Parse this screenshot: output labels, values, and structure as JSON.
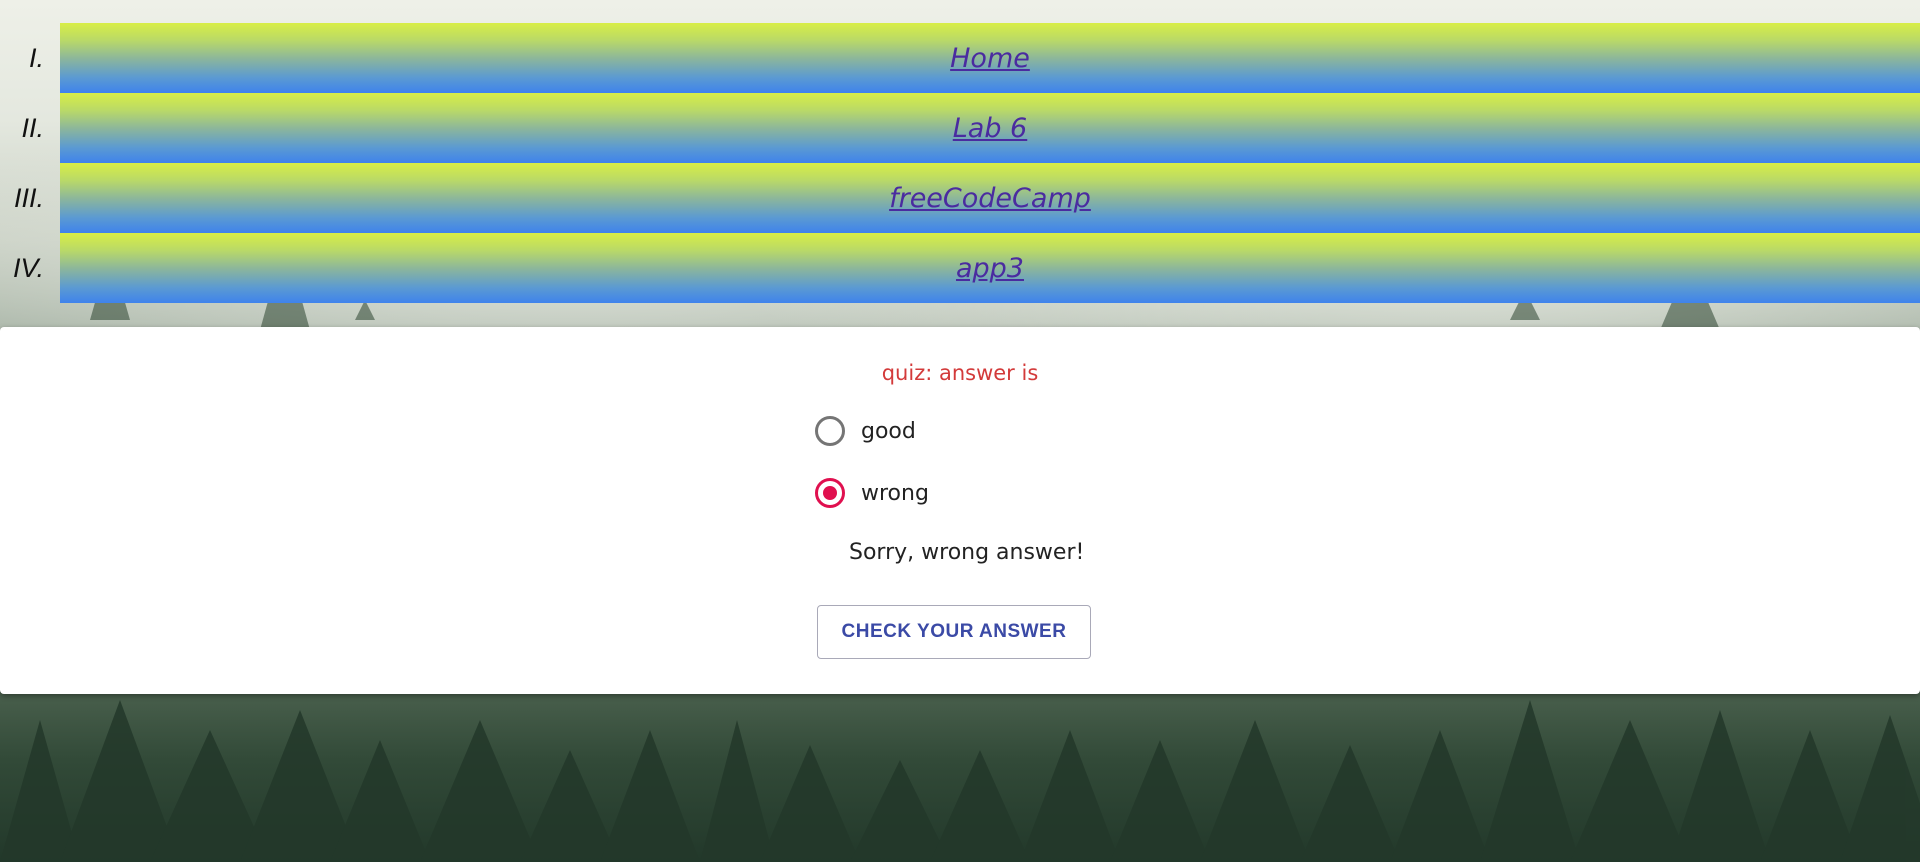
{
  "nav": {
    "items": [
      {
        "marker": "I.",
        "label": "Home"
      },
      {
        "marker": "II.",
        "label": "Lab 6"
      },
      {
        "marker": "III.",
        "label": "freeCodeCamp"
      },
      {
        "marker": "IV.",
        "label": "app3"
      }
    ],
    "gradient_colors": [
      "#d8ee46",
      "#3f83ec"
    ],
    "link_color": "#4a2ba0"
  },
  "quiz": {
    "question": "quiz: answer is",
    "question_color": "#d33a3a",
    "options": [
      {
        "label": "good",
        "selected": false
      },
      {
        "label": "wrong",
        "selected": true
      }
    ],
    "result_text": "Sorry, wrong answer!",
    "button_label": "CHECK YOUR ANSWER",
    "accent_color": "#e0104f",
    "button_color": "#3b4aa6"
  }
}
